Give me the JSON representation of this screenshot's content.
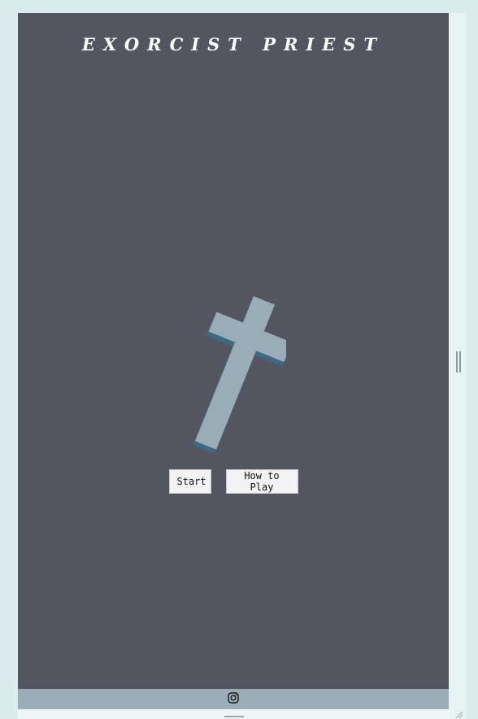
{
  "game": {
    "title": "Exorcist Priest",
    "background": "#535560",
    "cross_color": "#9aadb7",
    "cross_shadow": "#3d6a82"
  },
  "menu": {
    "start_label": "Start",
    "how_to_play_label": "How to Play"
  },
  "footer": {
    "icon": "instagram-icon",
    "background": "#9aadb7"
  }
}
